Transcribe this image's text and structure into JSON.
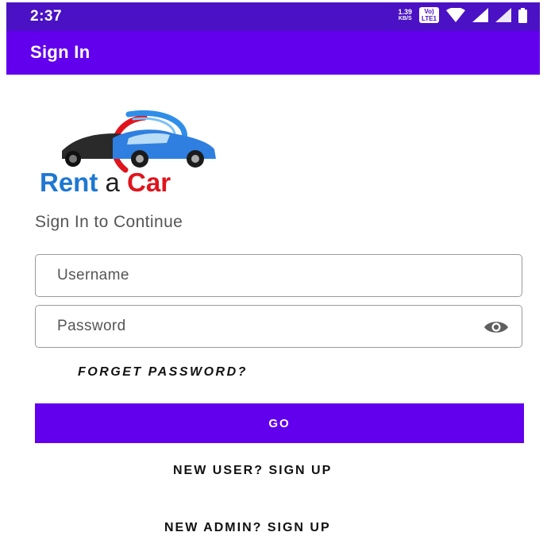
{
  "status_bar": {
    "time": "2:37",
    "net_speed_value": "1.39",
    "net_speed_unit": "KB/S",
    "volte_top": "Vo)",
    "volte_bottom": "LTE1"
  },
  "app_bar": {
    "title": "Sign In"
  },
  "logo": {
    "word1": "Rent",
    "word2": "a",
    "word3": "Car"
  },
  "subtitle": "Sign In to Continue",
  "form": {
    "username_placeholder": "Username",
    "password_placeholder": "Password",
    "forget_password_label": "FORGET PASSWORD?",
    "go_label": "GO",
    "new_user_label": "NEW USER? SIGN UP",
    "new_admin_label": "NEW ADMIN? SIGN UP"
  },
  "icons": {
    "wifi": "wifi-icon",
    "signal": "signal-icon",
    "battery": "battery-icon",
    "visibility": "eye-icon"
  },
  "colors": {
    "status_bar": "#4a12c4",
    "primary": "#6200ee",
    "logo_blue": "#1e78d2",
    "logo_red": "#e0141c"
  }
}
